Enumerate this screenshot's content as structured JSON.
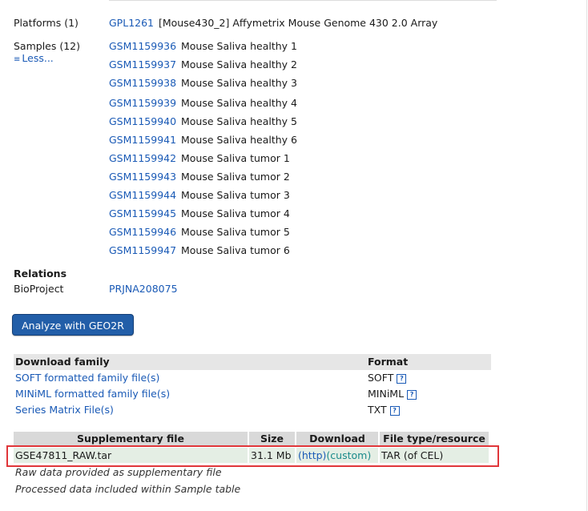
{
  "platforms": {
    "label": "Platforms (1)",
    "accession": "GPL1261",
    "description": "[Mouse430_2] Affymetrix Mouse Genome 430 2.0 Array"
  },
  "samples": {
    "label": "Samples (12)",
    "less_label": "Less...",
    "items": [
      {
        "acc": "GSM1159936",
        "title": "Mouse Saliva healthy 1"
      },
      {
        "acc": "GSM1159937",
        "title": "Mouse Saliva healthy 2"
      },
      {
        "acc": "GSM1159938",
        "title": "Mouse Saliva healthy 3"
      },
      {
        "acc": "GSM1159939",
        "title": "Mouse Saliva healthy 4"
      },
      {
        "acc": "GSM1159940",
        "title": "Mouse Saliva healthy 5"
      },
      {
        "acc": "GSM1159941",
        "title": "Mouse Saliva healthy 6"
      },
      {
        "acc": "GSM1159942",
        "title": "Mouse Saliva tumor 1"
      },
      {
        "acc": "GSM1159943",
        "title": "Mouse Saliva tumor 2"
      },
      {
        "acc": "GSM1159944",
        "title": "Mouse Saliva tumor 3"
      },
      {
        "acc": "GSM1159945",
        "title": "Mouse Saliva tumor 4"
      },
      {
        "acc": "GSM1159946",
        "title": "Mouse Saliva tumor 5"
      },
      {
        "acc": "GSM1159947",
        "title": "Mouse Saliva tumor 6"
      }
    ]
  },
  "relations": {
    "heading": "Relations",
    "bioproject_label": "BioProject",
    "bioproject_acc": "PRJNA208075"
  },
  "geo2r_button": "Analyze with GEO2R",
  "download_family": {
    "header": "Download family",
    "format_header": "Format",
    "rows": [
      {
        "name": "SOFT formatted family file(s)",
        "format": "SOFT"
      },
      {
        "name": "MINiML formatted family file(s)",
        "format": "MINiML"
      },
      {
        "name": "Series Matrix File(s)",
        "format": "TXT"
      }
    ],
    "help_glyph": "?"
  },
  "supplementary": {
    "headers": [
      "Supplementary file",
      "Size",
      "Download",
      "File type/resource"
    ],
    "row": {
      "file": "GSE47811_RAW.tar",
      "size": "31.1 Mb",
      "http": "(http)",
      "custom": "(custom)",
      "type": "TAR (of CEL)"
    },
    "note1": "Raw data provided as supplementary file",
    "note2": "Processed data included within Sample table"
  },
  "colors": {
    "link": "#1a5ab6",
    "button_bg": "#225ea8",
    "highlight_border": "#e0363a",
    "row_bg": "#e4eee4"
  }
}
